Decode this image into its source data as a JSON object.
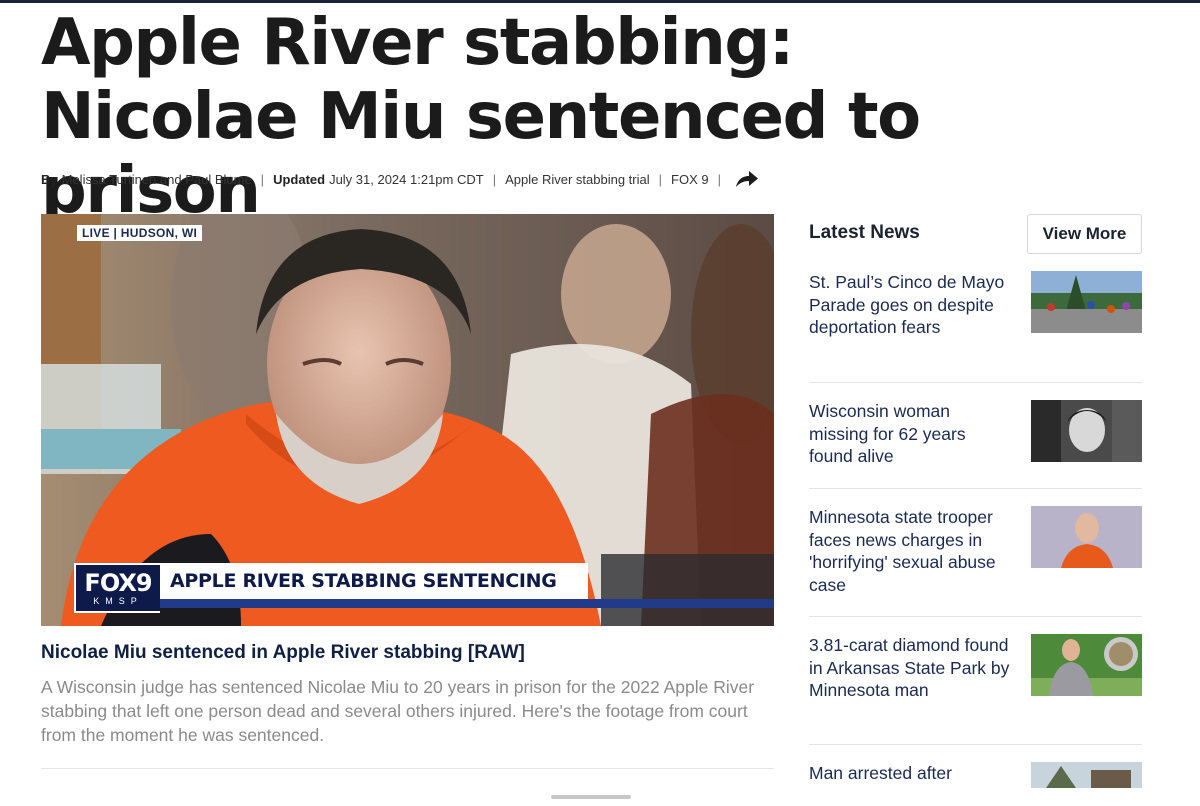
{
  "article": {
    "headline": "Apple River stabbing: Nicolae Miu sentenced to prison",
    "byline_prefix": "By",
    "authors": "Melissa Turtinen and Paul Blume",
    "updated_label": "Updated",
    "updated_time": "July 31, 2024 1:21pm CDT",
    "topic_link": "Apple River stabbing trial",
    "source": "FOX 9"
  },
  "video": {
    "live_tag": "LIVE | HUDSON, WI",
    "logo_main": "FOX9",
    "logo_sub": "KMSP",
    "lower_third": "APPLE RIVER STABBING SENTENCING",
    "caption_title": "Nicolae Miu sentenced in Apple River stabbing [RAW]",
    "caption_description": "A Wisconsin judge has sentenced Nicolae Miu to 20 years in prison for the 2022 Apple River stabbing that left one person dead and several others injured. Here's the footage from court from the moment he was sentenced."
  },
  "sidebar": {
    "title": "Latest News",
    "view_more": "View More",
    "items": [
      {
        "title": "St. Paul’s Cinco de Mayo Parade goes on despite deportation fears"
      },
      {
        "title": "Wisconsin woman missing for 62 years found alive"
      },
      {
        "title": "Minnesota state trooper faces news charges in 'horrifying' sexual abuse case"
      },
      {
        "title": "3.81-carat diamond found in Arkansas State Park by Minnesota man"
      },
      {
        "title": "Man arrested after"
      }
    ]
  },
  "colors": {
    "brand_navy": "#0e1a4a",
    "headline": "#1b1b1b",
    "link": "#1b2a52",
    "muted_text": "#8a8a8a"
  },
  "icons": {
    "share": "share-arrow-icon"
  }
}
